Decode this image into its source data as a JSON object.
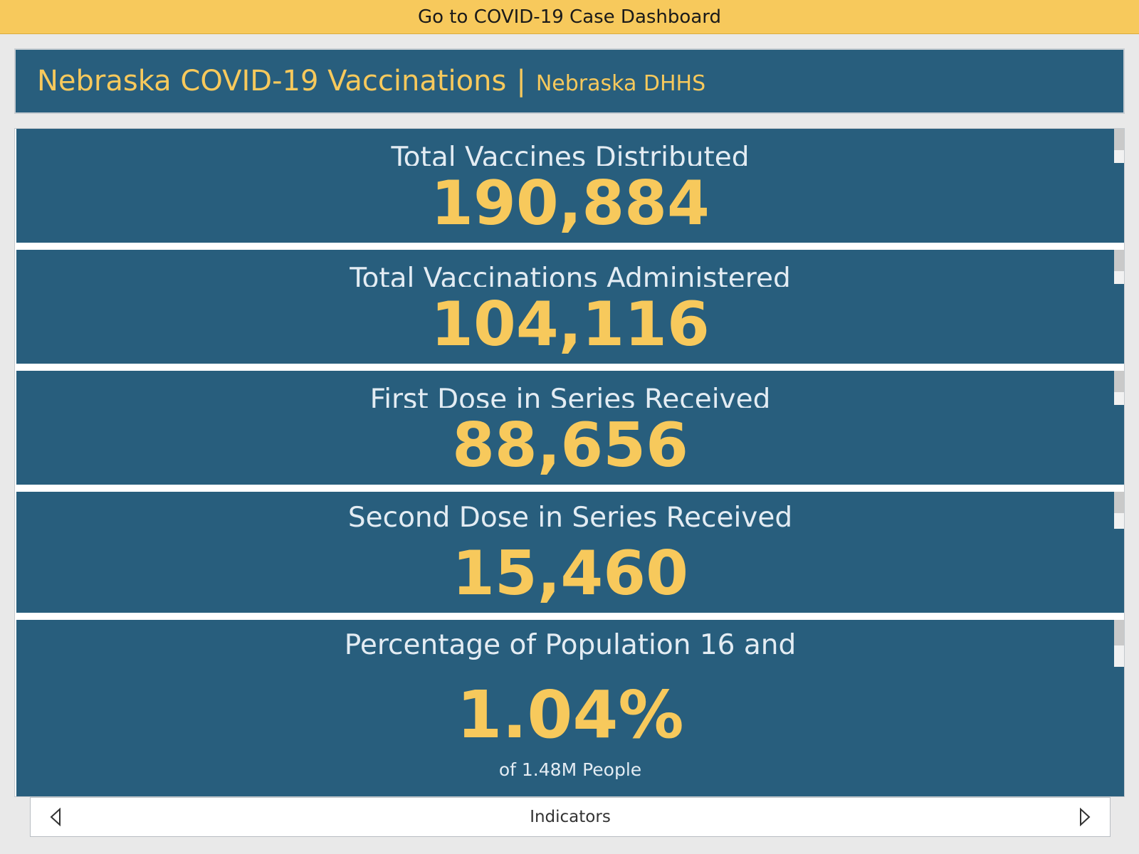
{
  "topbar": {
    "link_text": "Go to COVID-19 Case Dashboard"
  },
  "header": {
    "title": "Nebraska COVID-19 Vaccinations",
    "separator": "|",
    "org": "Nebraska DHHS"
  },
  "indicators": [
    {
      "label": "Total Vaccines Distributed",
      "value": "190,884"
    },
    {
      "label": "Total Vaccinations Administered",
      "value": "104,116"
    },
    {
      "label": "First Dose in Series Received",
      "value": "88,656"
    },
    {
      "label": "Second Dose in Series Received",
      "value": "15,460"
    },
    {
      "label": "Percentage of Population 16 and",
      "value": "1.04%",
      "sub": "of 1.48M People"
    }
  ],
  "footer": {
    "label": "Indicators",
    "prev_icon": "caret-left-icon",
    "next_icon": "caret-right-icon"
  },
  "colors": {
    "accent": "#f7c95c",
    "panel": "#285e7d",
    "background": "#e9e9e9"
  }
}
